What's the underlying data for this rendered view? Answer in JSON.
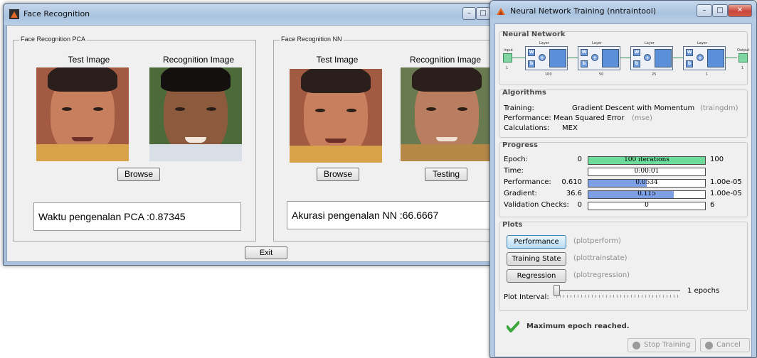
{
  "face_window": {
    "title": "Face Recognition",
    "panel_pca": {
      "legend": "Face Recognition PCA",
      "test_caption": "Test Image",
      "recog_caption": "Recognition Image",
      "browse_label": "Browse",
      "result_text": "Waktu pengenalan PCA :0.87345"
    },
    "panel_nn": {
      "legend": "Face Recognition NN",
      "test_caption": "Test Image",
      "recog_caption": "Recognition Image",
      "browse_label": "Browse",
      "testing_label": "Testing",
      "result_text": "Akurasi pengenalan NN :66.6667"
    },
    "exit_label": "Exit"
  },
  "nn_window": {
    "title": "Neural Network Training (nntraintool)",
    "network": {
      "section_title": "Neural Network",
      "input_label": "Input",
      "input_size": "1",
      "output_label": "Output",
      "output_size": "1",
      "layers": [
        {
          "label": "Layer",
          "size": "100"
        },
        {
          "label": "Layer",
          "size": "50"
        },
        {
          "label": "Layer",
          "size": "25"
        },
        {
          "label": "Layer",
          "size": "1"
        }
      ],
      "w_glyph": "W",
      "b_glyph": "b",
      "plus_glyph": "+"
    },
    "algorithms": {
      "section_title": "Algorithms",
      "training_label": "Training:",
      "training_value": "Gradient Descent with Momentum",
      "training_code": "(traingdm)",
      "performance_label": "Performance:",
      "performance_value": "Mean Squared Error",
      "performance_code": "(mse)",
      "calculations_label": "Calculations:",
      "calculations_value": "MEX"
    },
    "progress": {
      "section_title": "Progress",
      "rows": [
        {
          "label": "Epoch:",
          "start": "0",
          "text": "100 iterations",
          "end": "100",
          "fill_fraction": 1.0,
          "fill_color": "#6ddc9b"
        },
        {
          "label": "Time:",
          "start": "",
          "text": "0:00:01",
          "end": "",
          "fill_fraction": 0.0,
          "fill_color": "#ffffff"
        },
        {
          "label": "Performance:",
          "start": "0.610",
          "text": "0.0534",
          "end": "1.00e-05",
          "fill_fraction": 0.5,
          "fill_color": "#7d9fe6"
        },
        {
          "label": "Gradient:",
          "start": "36.6",
          "text": "0.115",
          "end": "1.00e-05",
          "fill_fraction": 0.73,
          "fill_color": "#7d9fe6"
        },
        {
          "label": "Validation Checks:",
          "start": "0",
          "text": "0",
          "end": "6",
          "fill_fraction": 0.0,
          "fill_color": "#ffffff"
        }
      ]
    },
    "plots": {
      "section_title": "Plots",
      "buttons": [
        {
          "label": "Performance",
          "fn": "(plotperform)"
        },
        {
          "label": "Training State",
          "fn": "(plottrainstate)"
        },
        {
          "label": "Regression",
          "fn": "(plotregression)"
        }
      ],
      "interval_label": "Plot Interval:",
      "interval_value": "1 epochs"
    },
    "status": {
      "message": "Maximum epoch reached.",
      "check_color": "#3aa53a"
    },
    "stop_label": "Stop Training",
    "cancel_label": "Cancel"
  }
}
